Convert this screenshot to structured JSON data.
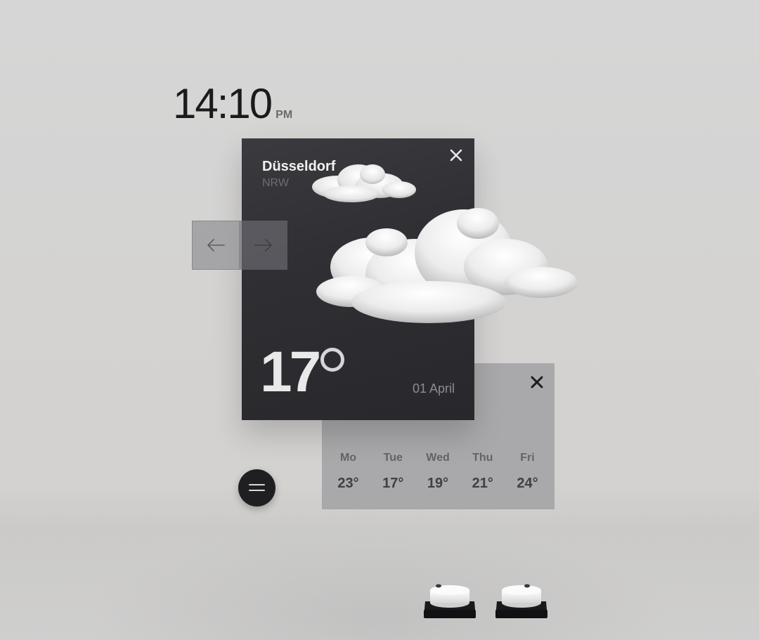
{
  "clock": {
    "time": "14:10",
    "period": "PM"
  },
  "weather": {
    "city": "Düsseldorf",
    "region": "NRW",
    "temperature": "17",
    "date": "01 April",
    "condition_icon": "cloud-icon"
  },
  "navigation": {
    "prev_icon": "arrow-left-icon",
    "next_icon": "arrow-right-icon"
  },
  "forecast": {
    "days": [
      {
        "day": "Mo",
        "temp": "23°"
      },
      {
        "day": "Tue",
        "temp": "17°"
      },
      {
        "day": "Wed",
        "temp": "19°"
      },
      {
        "day": "Thu",
        "temp": "21°"
      },
      {
        "day": "Fri",
        "temp": "24°"
      }
    ]
  },
  "colors": {
    "card_dark": "#2f2f34",
    "forecast_panel": "#a0a0a2",
    "background": "#d5d4d3"
  }
}
